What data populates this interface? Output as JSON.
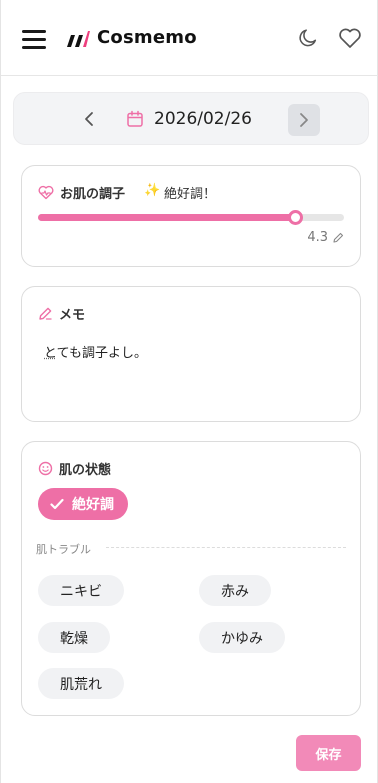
{
  "header": {
    "brand": "Cosmemo",
    "icons": {
      "menu": "hamburger-menu-icon",
      "logo": "cosmemo-logo-icon",
      "theme": "moon-icon",
      "favorite": "heart-icon"
    }
  },
  "date_nav": {
    "date": "2026/02/26",
    "prev_icon": "chevron-left-icon",
    "next_icon": "chevron-right-icon",
    "calendar_icon": "calendar-icon"
  },
  "condition": {
    "title": "お肌の調子",
    "mood_icon": "sparkles-icon",
    "mood": "絶好調！",
    "score": "4.3",
    "score_fraction": 0.84,
    "edit_icon": "pencil-icon"
  },
  "memo": {
    "title": "メモ",
    "text_first": "と",
    "text_rest": "ても調子よし。"
  },
  "skin_state": {
    "title": "肌の状態",
    "selected": "絶好調",
    "trouble_label": "肌トラブル",
    "troubles": [
      "ニキビ",
      "赤み",
      "乾燥",
      "かゆみ",
      "肌荒れ"
    ]
  },
  "actions": {
    "save": "保存"
  },
  "colors": {
    "accent": "#ee6fa6",
    "save_button": "#f28ab8",
    "track": "#e6e6e6",
    "date_bar": "#f3f4f6"
  }
}
